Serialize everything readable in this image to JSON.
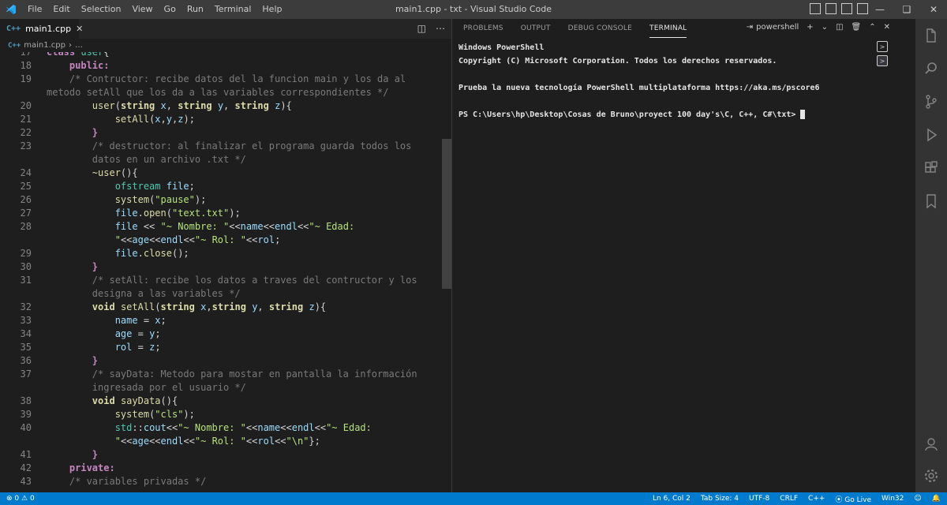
{
  "window": {
    "title": "main1.cpp - txt - Visual Studio Code",
    "menu": [
      "File",
      "Edit",
      "Selection",
      "View",
      "Go",
      "Run",
      "Terminal",
      "Help"
    ]
  },
  "editor": {
    "tab_label": "main1.cpp",
    "tab_icon": "C++ file icon",
    "breadcrumb_file": "main1.cpp",
    "breadcrumb_more": "…",
    "lines": [
      {
        "n": "17",
        "html": "<span class=\"kw\">class</span> <span class=\"cls\">user</span>{"
      },
      {
        "n": "18",
        "html": "    <span class=\"kw\">public:</span>"
      },
      {
        "n": "19",
        "html": "    <span class=\"cm\">/* Contructor: recibe datos del la funcion main y los da al</span>"
      },
      {
        "n": "",
        "html": "<span class=\"cm\">metodo setAll que los da a las variables correspondientes */</span>"
      },
      {
        "n": "20",
        "html": "        <span class=\"fn\">user</span>(<span class=\"ty\">string</span> <span class=\"pm\">x</span>, <span class=\"ty\">string</span> <span class=\"pm\">y</span>, <span class=\"ty\">string</span> <span class=\"pm\">z</span>){"
      },
      {
        "n": "21",
        "html": "            <span class=\"fn\">setAll</span>(<span class=\"pm\">x</span>,<span class=\"pm\">y</span>,<span class=\"pm\">z</span>);"
      },
      {
        "n": "22",
        "html": "        <span class=\"kw\">}</span>"
      },
      {
        "n": "23",
        "html": "        <span class=\"cm\">/* destructor: al finalizar el programa guarda todos los</span>"
      },
      {
        "n": "",
        "html": "        <span class=\"cm\">datos en un archivo .txt */</span>"
      },
      {
        "n": "24",
        "html": "        <span class=\"fn\">~user</span>(){"
      },
      {
        "n": "25",
        "html": "            <span class=\"cls\">ofstream</span> <span class=\"pm\">file</span>;"
      },
      {
        "n": "26",
        "html": "            <span class=\"fn\">system</span>(<span class=\"st\">\"pause\"</span>);"
      },
      {
        "n": "27",
        "html": "            <span class=\"pm\">file</span>.<span class=\"fn\">open</span>(<span class=\"st\">\"text.txt\"</span>);"
      },
      {
        "n": "28",
        "html": "            <span class=\"pm\">file</span> &lt;&lt; <span class=\"st\">\"~ Nombre: \"</span>&lt;&lt;<span class=\"pm\">name</span>&lt;&lt;<span class=\"pm\">endl</span>&lt;&lt;<span class=\"st\">\"~ Edad:</span>"
      },
      {
        "n": "",
        "html": "            <span class=\"st\">\"</span>&lt;&lt;<span class=\"pm\">age</span>&lt;&lt;<span class=\"pm\">endl</span>&lt;&lt;<span class=\"st\">\"~ Rol: \"</span>&lt;&lt;<span class=\"pm\">rol</span>;"
      },
      {
        "n": "29",
        "html": "            <span class=\"pm\">file</span>.<span class=\"fn\">close</span>();"
      },
      {
        "n": "30",
        "html": "        <span class=\"kw\">}</span>"
      },
      {
        "n": "31",
        "html": "        <span class=\"cm\">/* setAll: recibe los datos a traves del contructor y los</span>"
      },
      {
        "n": "",
        "html": "        <span class=\"cm\">designa a las variables */</span>"
      },
      {
        "n": "32",
        "html": "        <span class=\"ty\">void</span> <span class=\"fn\">setAll</span>(<span class=\"ty\">string</span> <span class=\"pm\">x</span>,<span class=\"ty\">string</span> <span class=\"pm\">y</span>, <span class=\"ty\">string</span> <span class=\"pm\">z</span>){"
      },
      {
        "n": "33",
        "html": "            <span class=\"pm\">name</span> = <span class=\"pm\">x</span>;"
      },
      {
        "n": "34",
        "html": "            <span class=\"pm\">age</span> = <span class=\"pm\">y</span>;"
      },
      {
        "n": "35",
        "html": "            <span class=\"pm\">rol</span> = <span class=\"pm\">z</span>;"
      },
      {
        "n": "36",
        "html": "        <span class=\"kw\">}</span>"
      },
      {
        "n": "37",
        "html": "        <span class=\"cm\">/* sayData: Metodo para mostar en pantalla la información</span>"
      },
      {
        "n": "",
        "html": "        <span class=\"cm\">ingresada por el usuario */</span>"
      },
      {
        "n": "38",
        "html": "        <span class=\"ty\">void</span> <span class=\"fn\">sayData</span>(){"
      },
      {
        "n": "39",
        "html": "            <span class=\"fn\">system</span>(<span class=\"st\">\"cls\"</span>);"
      },
      {
        "n": "40",
        "html": "            <span class=\"cls\">std</span>::<span class=\"pm\">cout</span>&lt;&lt;<span class=\"st\">\"~ Nombre: \"</span>&lt;&lt;<span class=\"pm\">name</span>&lt;&lt;<span class=\"pm\">endl</span>&lt;&lt;<span class=\"st\">\"~ Edad:</span>"
      },
      {
        "n": "",
        "html": "            <span class=\"st\">\"</span>&lt;&lt;<span class=\"pm\">age</span>&lt;&lt;<span class=\"pm\">endl</span>&lt;&lt;<span class=\"st\">\"~ Rol: \"</span>&lt;&lt;<span class=\"pm\">rol</span>&lt;&lt;<span class=\"st\">\"\\n\"</span>};"
      },
      {
        "n": "41",
        "html": "        <span class=\"kw\">}</span>"
      },
      {
        "n": "42",
        "html": "    <span class=\"kw\">private:</span>"
      },
      {
        "n": "43",
        "html": "    <span class=\"cm\">/* variables privadas */</span>"
      }
    ]
  },
  "panel": {
    "tabs": [
      "PROBLEMS",
      "OUTPUT",
      "DEBUG CONSOLE",
      "TERMINAL"
    ],
    "active_tab": "TERMINAL",
    "terminal_name": "powershell",
    "terminal_lines": [
      "Windows PowerShell",
      "Copyright (C) Microsoft Corporation. Todos los derechos reservados.",
      "",
      "Prueba la nueva tecnología PowerShell multiplataforma https://aka.ms/pscore6",
      "",
      "PS C:\\Users\\hp\\Desktop\\Cosas de Bruno\\proyect 100 day's\\C, C++, C#\\txt> "
    ]
  },
  "statusbar": {
    "errors": "0",
    "warnings": "0",
    "position": "Ln 6, Col 2",
    "tab_size": "Tab Size: 4",
    "encoding": "UTF-8",
    "eol": "CRLF",
    "language": "C++",
    "go_live": "Go Live",
    "platform": "Win32"
  },
  "colors": {
    "accent": "#007acc",
    "titlebar": "#3c3c3c",
    "editor_bg": "#1e1e1e"
  }
}
